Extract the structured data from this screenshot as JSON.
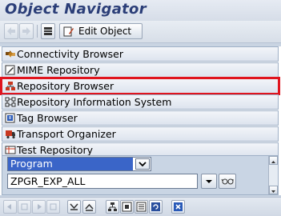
{
  "window": {
    "title": "Object Navigator"
  },
  "toolbar": {
    "edit_object_label": "Edit Object"
  },
  "nav_items": [
    {
      "label": "Connectivity Browser",
      "icon": "connectivity-icon"
    },
    {
      "label": "MIME Repository",
      "icon": "mime-icon"
    },
    {
      "label": "Repository Browser",
      "icon": "repository-tree-icon",
      "highlighted": true
    },
    {
      "label": "Repository Information System",
      "icon": "info-system-icon"
    },
    {
      "label": "Tag Browser",
      "icon": "tag-icon"
    },
    {
      "label": "Transport Organizer",
      "icon": "truck-icon"
    },
    {
      "label": "Test Repository",
      "icon": "test-icon"
    }
  ],
  "object_selector": {
    "selected": "Program"
  },
  "object_name": {
    "value": "ZPGR_EXP_ALL"
  },
  "colors": {
    "title": "#2b3e78",
    "highlight": "#e0141e",
    "selected_bg": "#3a65c8"
  }
}
